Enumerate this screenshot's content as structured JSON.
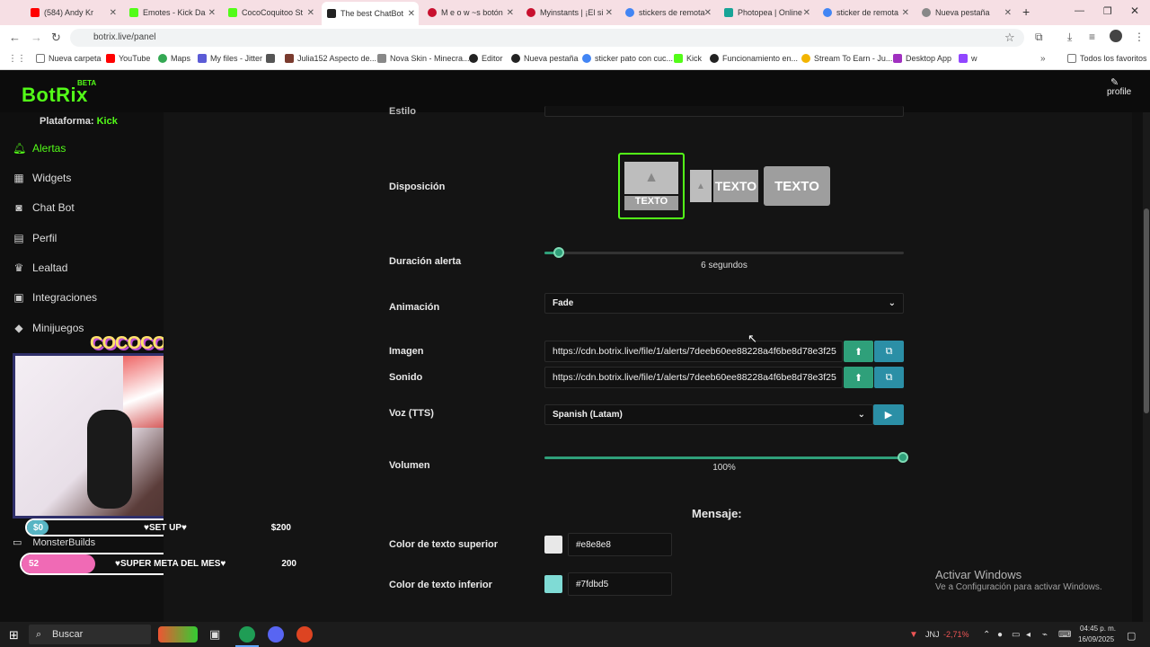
{
  "browser": {
    "tabs": [
      {
        "label": "(584) Andy Kr",
        "color": "#ff0000"
      },
      {
        "label": "Emotes - Kick Da",
        "color": "#53fc18"
      },
      {
        "label": "CocoCoquitoo St",
        "color": "#53fc18"
      },
      {
        "label": "The best ChatBot",
        "color": "#222222",
        "active": true
      },
      {
        "label": "M e o w ~s botón",
        "color": "#c8102e"
      },
      {
        "label": "Myinstants | ¡El si",
        "color": "#c8102e"
      },
      {
        "label": "stickers de remota",
        "color": "#4285f4"
      },
      {
        "label": "Photopea | Online",
        "color": "#18a497"
      },
      {
        "label": "sticker de remota",
        "color": "#4285f4"
      },
      {
        "label": "Nueva pestaña",
        "color": "#888888"
      }
    ],
    "url": "botrix.live/panel",
    "bookmarks": [
      "Nueva carpeta",
      "YouTube",
      "Maps",
      "My files - Jitter",
      "Julia152 Aspecto de...",
      "Nova Skin - Minecra...",
      "Editor",
      "Nueva pestaña",
      "sticker pato con cuc...",
      "Kick",
      "Funcionamiento en...",
      "Stream To Earn - Ju...",
      "Desktop App",
      "w"
    ],
    "bookmarks_right": "Todos los favoritos"
  },
  "app": {
    "logo": "BotRix",
    "beta": "BETA",
    "profile": "profile",
    "platform_label": "Plataforma:",
    "platform_value": "Kick"
  },
  "sidebar": {
    "items": [
      {
        "label": "Alertas",
        "icon": "bell-icon",
        "active": true
      },
      {
        "label": "Widgets",
        "icon": "grid-icon"
      },
      {
        "label": "Chat Bot",
        "icon": "robot-icon"
      },
      {
        "label": "Perfil",
        "icon": "id-card-icon"
      },
      {
        "label": "Lealtad",
        "icon": "trophy-icon"
      },
      {
        "label": "Integraciones",
        "icon": "plug-icon"
      },
      {
        "label": "Minijuegos",
        "icon": "gamepad-icon"
      }
    ],
    "monster": "MonsterBuilds"
  },
  "overlay": {
    "title": "COCOCOQUITOO",
    "goal1": {
      "current": "$0",
      "label": "♥SET UP♥",
      "target": "$200"
    },
    "goal2": {
      "current": "52",
      "label": "♥SUPER META DEL MES♥",
      "target": "200"
    }
  },
  "form": {
    "estilo_label": "Estilo",
    "disposicion_label": "Disposición",
    "disp_text": "TEXTO",
    "duracion_label": "Duración alerta",
    "duracion_value": "6 segundos",
    "duracion_fraction": 0.04,
    "animacion_label": "Animación",
    "animacion_value": "Fade",
    "imagen_label": "Imagen",
    "imagen_url": "https://cdn.botrix.live/file/1/alerts/7deeb60ee88228a4f6be8d78e3f25",
    "sonido_label": "Sonido",
    "sonido_url": "https://cdn.botrix.live/file/1/alerts/7deeb60ee88228a4f6be8d78e3f25",
    "voz_label": "Voz (TTS)",
    "voz_value": "Spanish (Latam)",
    "volumen_label": "Volumen",
    "volumen_value": "100%",
    "volumen_fraction": 1.0,
    "mensaje_heading": "Mensaje:",
    "color_superior_label": "Color de texto superior",
    "color_superior_value": "#e8e8e8",
    "color_inferior_label": "Color de texto inferior",
    "color_inferior_value": "#7fdbd5"
  },
  "windows": {
    "activate_title": "Activar Windows",
    "activate_sub": "Ve a Configuración para activar Windows.",
    "search": "Buscar",
    "stock": "JNJ",
    "stock_change": "-2,71%",
    "time": "04:45 p. m.",
    "date": "16/09/2025"
  }
}
